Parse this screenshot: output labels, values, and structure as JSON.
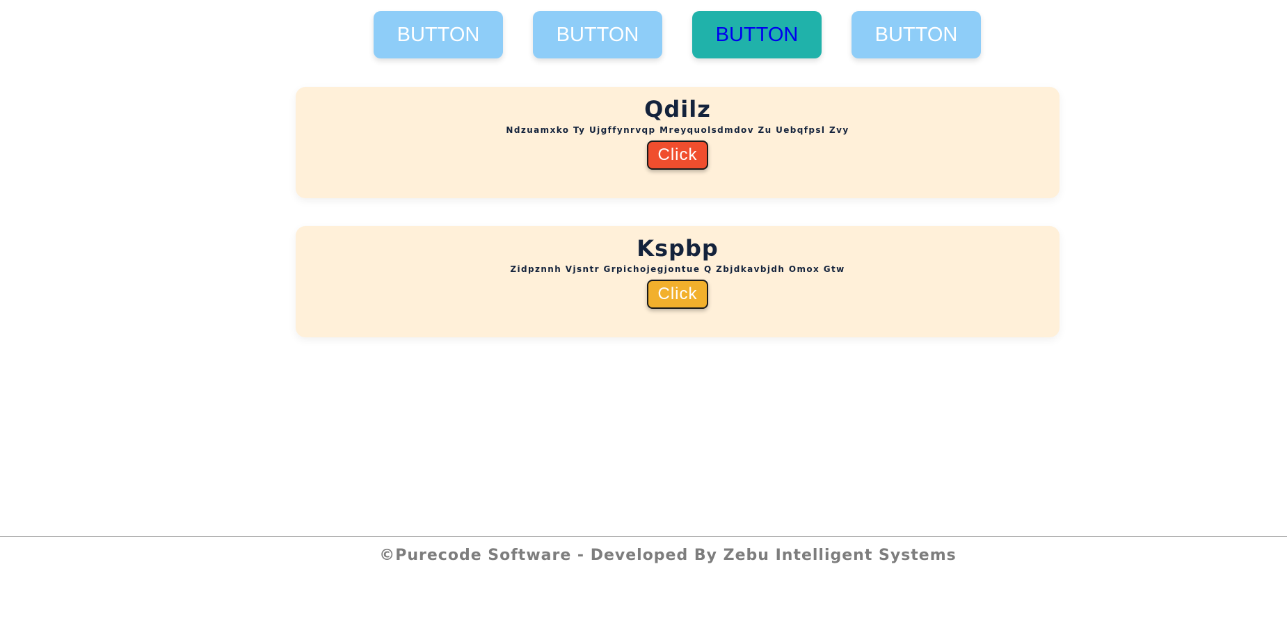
{
  "nav": {
    "buttons": [
      {
        "label": "BUTTON",
        "active": false
      },
      {
        "label": "BUTTON",
        "active": false
      },
      {
        "label": "BUTTON",
        "active": true
      },
      {
        "label": "BUTTON",
        "active": false
      }
    ]
  },
  "cards": [
    {
      "title": "Qdilz",
      "subtitle": "Ndzuamxko Ty Ujgffynrvqp Mreyquolsdmdov Zu Uebqfpsl Zvy",
      "button_label": "Click",
      "button_color": "#f04e2e"
    },
    {
      "title": "Kspbp",
      "subtitle": "Zidpznnh Vjsntr Grpichojegjontue Q Zbjdkavbjdh Omox Gtw",
      "button_label": "Click",
      "button_color": "#f2b02c"
    }
  ],
  "footer": {
    "text": "©Purecode Software - Developed By Zebu Intelligent Systems"
  },
  "colors": {
    "nav_button": "#8ecdf8",
    "nav_button_active": "#20b2aa",
    "card_background": "#fff0d9",
    "title_text": "#14233c",
    "footer_text": "#7d7d7d"
  }
}
